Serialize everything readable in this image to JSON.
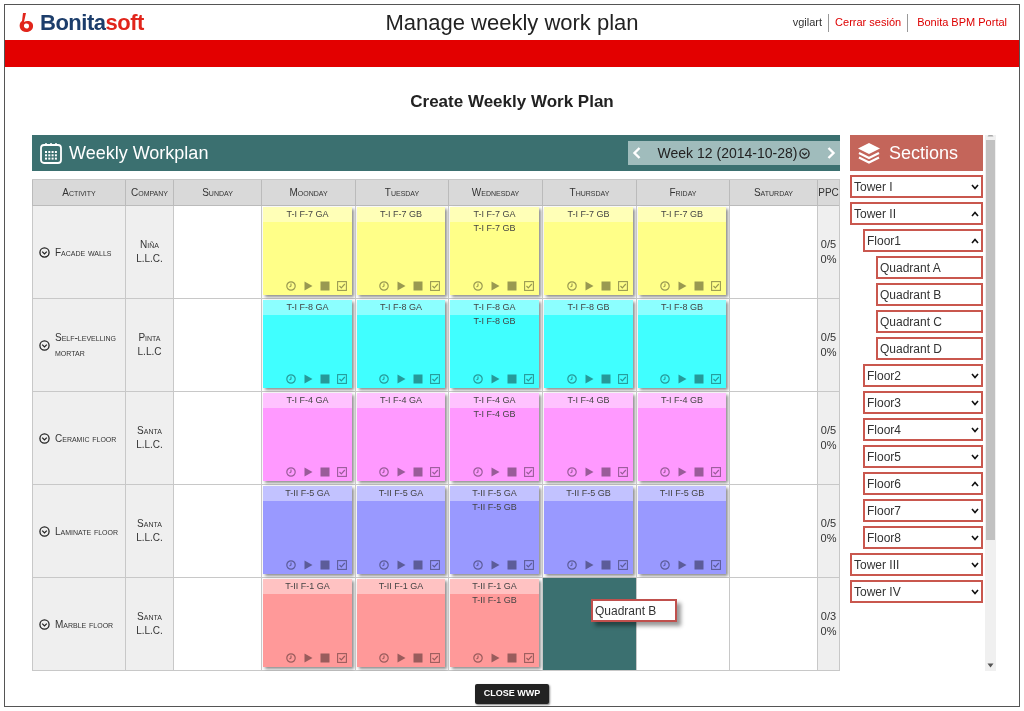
{
  "header": {
    "logo": {
      "primary": "Bonita",
      "accent": "soft"
    },
    "title": "Manage weekly work plan",
    "user": "vgilart",
    "logout": "Cerrar sesión",
    "portal": "Bonita BPM Portal"
  },
  "page_title": "Create Weekly Work Plan",
  "workplan": {
    "title": "Weekly Workplan",
    "week": "Week 12 (2014-10-28)",
    "columns": [
      "Activity",
      "Company",
      "Sunday",
      "Moonday",
      "Tuesday",
      "Wednesday",
      "Thursday",
      "Friday",
      "Saturday",
      "PPC"
    ],
    "rows": [
      {
        "color": "#ffff88",
        "cells": [
          {
            "kind": "activity",
            "text": "Facade walls"
          },
          {
            "kind": "company",
            "text": "Niña L.L.C."
          },
          {
            "kind": "empty"
          },
          {
            "kind": "card",
            "tags": [
              "T-I F-7 GA"
            ]
          },
          {
            "kind": "card",
            "tags": [
              "T-I F-7 GB"
            ]
          },
          {
            "kind": "card",
            "tags": [
              "T-I F-7 GA",
              "T-I F-7 GB"
            ]
          },
          {
            "kind": "card",
            "tags": [
              "T-I F-7 GB"
            ]
          },
          {
            "kind": "card",
            "tags": [
              "T-I F-7 GB"
            ]
          },
          {
            "kind": "empty"
          },
          {
            "kind": "ppc",
            "lines": [
              "0/5",
              "0%"
            ]
          }
        ]
      },
      {
        "color": "#40ffff",
        "cells": [
          {
            "kind": "activity",
            "text": "Self-levelling mortar"
          },
          {
            "kind": "company",
            "text": "Pinta L.L.C"
          },
          {
            "kind": "empty"
          },
          {
            "kind": "card",
            "tags": [
              "T-I F-8 GA"
            ]
          },
          {
            "kind": "card",
            "tags": [
              "T-I F-8 GA"
            ]
          },
          {
            "kind": "card",
            "tags": [
              "T-I F-8 GA",
              "T-I F-8 GB"
            ]
          },
          {
            "kind": "card",
            "tags": [
              "T-I F-8 GB"
            ]
          },
          {
            "kind": "card",
            "tags": [
              "T-I F-8 GB"
            ]
          },
          {
            "kind": "empty"
          },
          {
            "kind": "ppc",
            "lines": [
              "0/5",
              "0%"
            ]
          }
        ]
      },
      {
        "color": "#ff99ff",
        "cells": [
          {
            "kind": "activity",
            "text": "Ceramic floor"
          },
          {
            "kind": "company",
            "text": "Santa L.L.C."
          },
          {
            "kind": "empty"
          },
          {
            "kind": "card",
            "tags": [
              "T-I F-4 GA"
            ]
          },
          {
            "kind": "card",
            "tags": [
              "T-I F-4 GA"
            ]
          },
          {
            "kind": "card",
            "tags": [
              "T-I F-4 GA",
              "T-I F-4 GB"
            ]
          },
          {
            "kind": "card",
            "tags": [
              "T-I F-4 GB"
            ]
          },
          {
            "kind": "card",
            "tags": [
              "T-I F-4 GB"
            ]
          },
          {
            "kind": "empty"
          },
          {
            "kind": "ppc",
            "lines": [
              "0/5",
              "0%"
            ]
          }
        ]
      },
      {
        "color": "#9999ff",
        "cells": [
          {
            "kind": "activity",
            "text": "Laminate floor"
          },
          {
            "kind": "company",
            "text": "Santa L.L.C."
          },
          {
            "kind": "empty"
          },
          {
            "kind": "card",
            "tags": [
              "T-II F-5 GA"
            ]
          },
          {
            "kind": "card",
            "tags": [
              "T-II F-5 GA"
            ]
          },
          {
            "kind": "card",
            "tags": [
              "T-II F-5 GA",
              "T-II F-5 GB"
            ]
          },
          {
            "kind": "card",
            "tags": [
              "T-II F-5 GB"
            ]
          },
          {
            "kind": "card",
            "tags": [
              "T-II F-5 GB"
            ]
          },
          {
            "kind": "empty"
          },
          {
            "kind": "ppc",
            "lines": [
              "0/5",
              "0%"
            ]
          }
        ]
      },
      {
        "color": "#ff9999",
        "dragged": "Quadrant B",
        "cells": [
          {
            "kind": "activity",
            "text": "Marble floor"
          },
          {
            "kind": "company",
            "text": "Santa L.L.C."
          },
          {
            "kind": "empty"
          },
          {
            "kind": "card",
            "tags": [
              "T-II F-1 GA"
            ]
          },
          {
            "kind": "card",
            "tags": [
              "T-II F-1 GA"
            ]
          },
          {
            "kind": "card",
            "tags": [
              "T-II F-1 GA",
              "T-II F-1 GB"
            ]
          },
          {
            "kind": "drop"
          },
          {
            "kind": "empty"
          },
          {
            "kind": "empty"
          },
          {
            "kind": "ppc",
            "lines": [
              "0/3",
              "0%"
            ]
          }
        ]
      }
    ]
  },
  "sections": {
    "title": "Sections",
    "items": [
      {
        "label": "Tower I",
        "expanded": false
      },
      {
        "label": "Tower II",
        "expanded": true,
        "children": [
          {
            "label": "Floor1",
            "expanded": true,
            "children": [
              {
                "label": "Quadrant A"
              },
              {
                "label": "Quadrant B"
              },
              {
                "label": "Quadrant C"
              },
              {
                "label": "Quadrant D"
              }
            ]
          },
          {
            "label": "Floor2",
            "expanded": false
          },
          {
            "label": "Floor3",
            "expanded": false
          },
          {
            "label": "Floor4",
            "expanded": false
          },
          {
            "label": "Floor5",
            "expanded": false
          },
          {
            "label": "Floor6",
            "expanded": true
          },
          {
            "label": "Floor7",
            "expanded": false
          },
          {
            "label": "Floor8",
            "expanded": false
          }
        ]
      },
      {
        "label": "Tower III",
        "expanded": false
      },
      {
        "label": "Tower IV",
        "expanded": false
      }
    ]
  },
  "close_button": "CLOSE WWP"
}
